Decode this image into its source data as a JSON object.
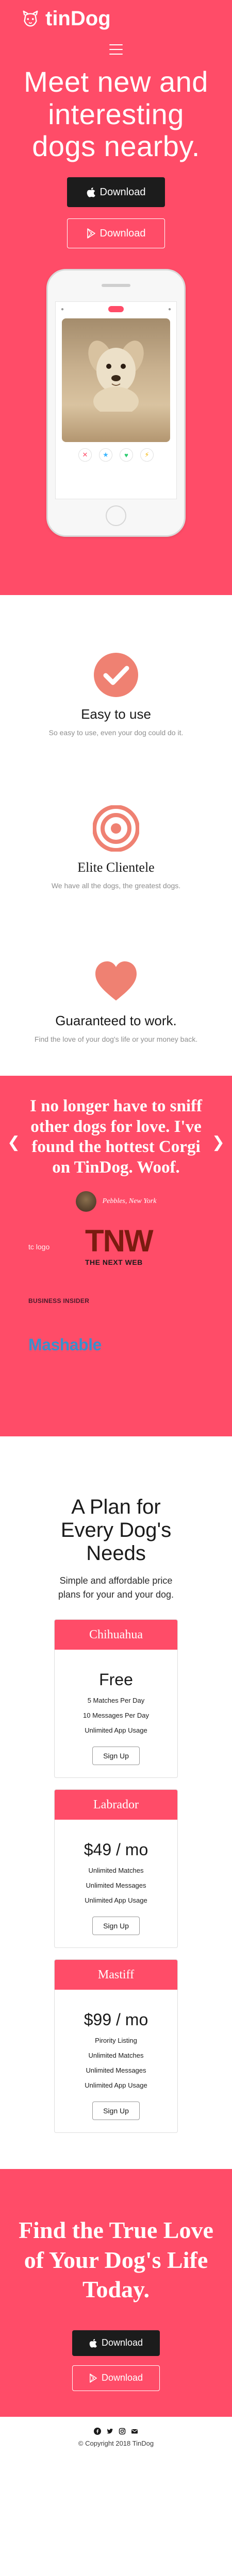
{
  "brand": {
    "name": "tinDog"
  },
  "hero": {
    "heading": "Meet new and interesting dogs nearby.",
    "download_primary": "Download",
    "download_secondary": "Download"
  },
  "features": [
    {
      "icon": "check-circle-icon",
      "title": "Easy to use",
      "text": "So easy to use, even your dog could do it."
    },
    {
      "icon": "bullseye-icon",
      "title": "Elite Clientele",
      "text": "We have all the dogs, the greatest dogs."
    },
    {
      "icon": "heart-icon",
      "title": "Guaranteed to work.",
      "text": "Find the love of your dog's life or your money back."
    }
  ],
  "testimonial": {
    "quote": "I no longer have to sniff other dogs for love. I've found the hottest Corgi on TinDog. Woof.",
    "author": "Pebbles, New York"
  },
  "press": {
    "techcrunch": "tc logo",
    "tnw": "TNW",
    "tnw_sub": "THE NEXT WEB",
    "business_insider": "BUSINESS INSIDER",
    "mashable": "Mashable"
  },
  "pricing": {
    "heading": "A Plan for Every Dog's Needs",
    "subheading": "Simple and affordable price plans for your and your dog.",
    "plans": [
      {
        "name": "Chihuahua",
        "price": "Free",
        "features": [
          "5 Matches Per Day",
          "10 Messages Per Day",
          "Unlimited App Usage"
        ],
        "button": "Sign Up"
      },
      {
        "name": "Labrador",
        "price": "$49 / mo",
        "features": [
          "Unlimited Matches",
          "Unlimited Messages",
          "Unlimited App Usage"
        ],
        "button": "Sign Up"
      },
      {
        "name": "Mastiff",
        "price": "$99 / mo",
        "features": [
          "Pirority Listing",
          "Unlimited Matches",
          "Unlimited Messages",
          "Unlimited App Usage"
        ],
        "button": "Sign Up"
      }
    ]
  },
  "cta": {
    "heading": "Find the True Love of Your Dog's Life Today.",
    "download_primary": "Download",
    "download_secondary": "Download"
  },
  "footer": {
    "social_icons": [
      "facebook-icon",
      "twitter-icon",
      "instagram-icon",
      "email-icon"
    ],
    "copyright": "© Copyright 2018 TinDog"
  },
  "colors": {
    "accent": "#ff4c68",
    "dark": "#1c1c1c"
  }
}
